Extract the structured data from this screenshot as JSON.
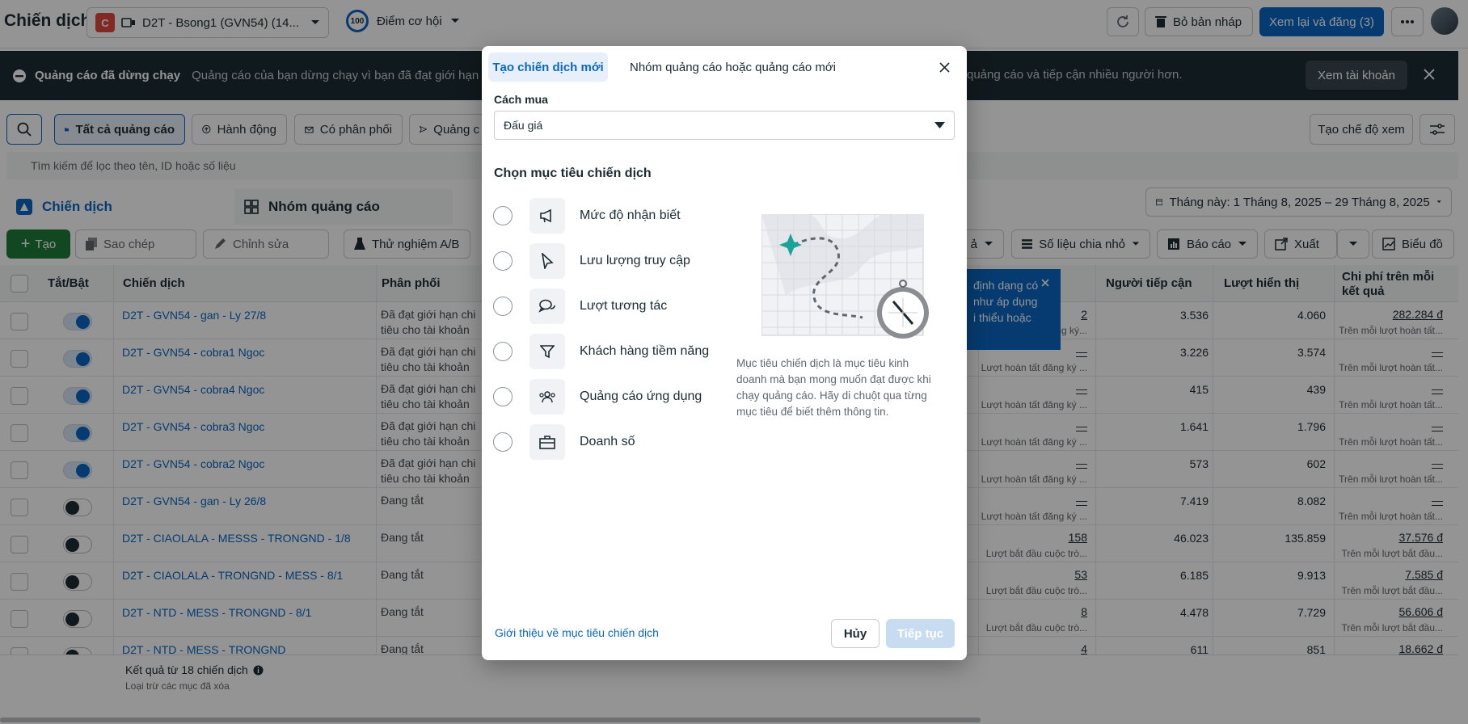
{
  "header": {
    "title": "Chiến dịch",
    "account_badge": "C",
    "account_name": "D2T - Bsong1 (GVN54) (14...",
    "score_value": "100",
    "score_label": "Điểm cơ hội",
    "discard_label": "Bỏ bản nháp",
    "review_publish_label": "Xem lại và đăng (3)"
  },
  "banner": {
    "title": "Quảng cáo đã dừng chạy",
    "text_left": "Quảng cáo của bạn dừng chạy vì bạn đã đạt giới hạn chi tiêu",
    "text_right": "quảng cáo và tiếp cận nhiều người hơn.",
    "button": "Xem tài khoản"
  },
  "filters": {
    "all_ads": "Tất cả quảng cáo",
    "actions": "Hành động",
    "delivery": "Có phân phối",
    "ads_partial": "Quảng c",
    "create_view": "Tạo chế độ xem",
    "search_placeholder": "Tìm kiếm để lọc theo tên, ID hoặc số liệu"
  },
  "tabs": {
    "campaigns": "Chiến dịch",
    "adsets": "Nhóm quảng cáo",
    "date_range": "Tháng này: 1 Tháng 8, 2025 – 29 Tháng 8, 2025"
  },
  "toolbar": {
    "create": "Tạo",
    "copy": "Sao chép",
    "edit": "Chỉnh sửa",
    "ab_test": "Thử nghiệm A/B",
    "partial": "ả",
    "breakdown": "Số liệu chia nhỏ",
    "reports": "Báo cáo",
    "export": "Xuất",
    "charts": "Biểu đồ"
  },
  "table": {
    "headers": {
      "toggle": "Tắt/Bật",
      "campaign": "Chiến dịch",
      "delivery": "Phân phối",
      "reach": "Người tiếp cận",
      "impressions": "Lượt hiển thị",
      "cost": "Chi phí trên mỗi kết quả"
    },
    "tooltip": {
      "line1": "định dạng có",
      "line2": "như áp dụng",
      "line3": "i thiểu hoặc"
    },
    "rows": [
      {
        "on": true,
        "name": "D2T - GVN54 - gan - Ly 27/8",
        "status1": "Đã đạt giới hạn chi",
        "status2": "tiêu cho tài khoản",
        "results": "2",
        "results_sub": "Lượt hoàn tất đăng ký...",
        "reach": "3.536",
        "impressions": "4.060",
        "cost": "282.284 đ",
        "cost_sub": "Trên mỗi lượt hoàn tất..."
      },
      {
        "on": true,
        "name": "D2T - GVN54 - cobra1 Ngoc",
        "status1": "Đã đạt giới hạn chi",
        "status2": "tiêu cho tài khoản",
        "results": "—",
        "results_sub": "Lượt hoàn tất đăng ký ...",
        "reach": "3.226",
        "impressions": "3.574",
        "cost": "—",
        "cost_sub": "Trên mỗi lượt hoàn tất..."
      },
      {
        "on": true,
        "name": "D2T - GVN54 - cobra4 Ngoc",
        "status1": "Đã đạt giới hạn chi",
        "status2": "tiêu cho tài khoản",
        "results": "—",
        "results_sub": "Lượt hoàn tất đăng ký ...",
        "reach": "415",
        "impressions": "439",
        "cost": "—",
        "cost_sub": "Trên mỗi lượt hoàn tất..."
      },
      {
        "on": true,
        "name": "D2T - GVN54 - cobra3 Ngoc",
        "status1": "Đã đạt giới hạn chi",
        "status2": "tiêu cho tài khoản",
        "results": "—",
        "results_sub": "Lượt hoàn tất đăng ký ...",
        "reach": "1.641",
        "impressions": "1.796",
        "cost": "—",
        "cost_sub": "Trên mỗi lượt hoàn tất..."
      },
      {
        "on": true,
        "name": "D2T - GVN54 - cobra2 Ngoc",
        "status1": "Đã đạt giới hạn chi",
        "status2": "tiêu cho tài khoản",
        "results": "—",
        "results_sub": "Lượt hoàn tất đăng ký ...",
        "reach": "573",
        "impressions": "602",
        "cost": "—",
        "cost_sub": "Trên mỗi lượt hoàn tất..."
      },
      {
        "on": false,
        "name": "D2T - GVN54 - gan - Ly 26/8",
        "status1": "Đang tắt",
        "status2": "",
        "results": "—",
        "results_sub": "Lượt hoàn tất đăng ký ...",
        "reach": "7.419",
        "impressions": "8.082",
        "cost": "—",
        "cost_sub": "Trên mỗi lượt hoàn tất..."
      },
      {
        "on": false,
        "name": "D2T - CIAOLALA - MESSS - TRONGND - 1/8",
        "status1": "Đang tắt",
        "status2": "",
        "results": "158",
        "results_sub": "Lượt bắt đầu cuộc trò...",
        "reach": "46.023",
        "impressions": "135.859",
        "cost": "37.576 đ",
        "cost_sub": "Trên mỗi lượt bắt đầu..."
      },
      {
        "on": false,
        "name": "D2T - CIAOLALA - TRONGND - MESS - 8/1",
        "status1": "Đang tắt",
        "status2": "",
        "results": "53",
        "results_sub": "Lượt bắt đầu cuộc trò...",
        "reach": "6.185",
        "impressions": "9.913",
        "cost": "7.585 đ",
        "cost_sub": "Trên mỗi lượt bắt đầu..."
      },
      {
        "on": false,
        "name": "D2T - NTD - MESS - TRONGND - 8/1",
        "status1": "Đang tắt",
        "status2": "",
        "results": "8",
        "results_sub": "Lượt bắt đầu cuộc trò...",
        "reach": "4.478",
        "impressions": "7.729",
        "cost": "56.606 đ",
        "cost_sub": "Trên mỗi lượt bắt đầu..."
      },
      {
        "on": false,
        "name": "D2T - NTD - MESS - TRONGND",
        "status1": "Đang tắt",
        "status2": "",
        "results": "4",
        "results_sub": "",
        "reach": "611",
        "impressions": "851",
        "cost": "18.662 đ",
        "cost_sub": ""
      }
    ],
    "footer_title": "Kết quả từ 18 chiến dịch",
    "footer_sub": "Loại trừ các mục đã xóa"
  },
  "modal": {
    "tab_new": "Tạo chiến dịch mới",
    "tab_existing": "Nhóm quảng cáo hoặc quảng cáo mới",
    "buying_label": "Cách mua",
    "buying_value": "Đấu giá",
    "objective_title": "Chọn mục tiêu chiến dịch",
    "objectives": [
      {
        "label": "Mức độ nhận biết",
        "icon": "megaphone-icon"
      },
      {
        "label": "Lưu lượng truy cập",
        "icon": "cursor-icon"
      },
      {
        "label": "Lượt tương tác",
        "icon": "chat-bubbles-icon"
      },
      {
        "label": "Khách hàng tiềm năng",
        "icon": "funnel-icon"
      },
      {
        "label": "Quảng cáo ứng dụng",
        "icon": "people-icon"
      },
      {
        "label": "Doanh số",
        "icon": "briefcase-icon"
      }
    ],
    "description": [
      "Mục tiêu chiến dịch là mục tiêu kinh",
      "doanh mà bạn mong muốn đạt được khi",
      "chạy quảng cáo. Hãy di chuột qua từng",
      "mục tiêu để biết thêm thông tin."
    ],
    "about_link": "Giới thiệu về mục tiêu chiến dịch",
    "cancel": "Hủy",
    "continue": "Tiếp tục"
  },
  "colors": {
    "accent": "#0a66c2",
    "banner": "#1c2b33",
    "primary_green": "#1e7d3c"
  }
}
